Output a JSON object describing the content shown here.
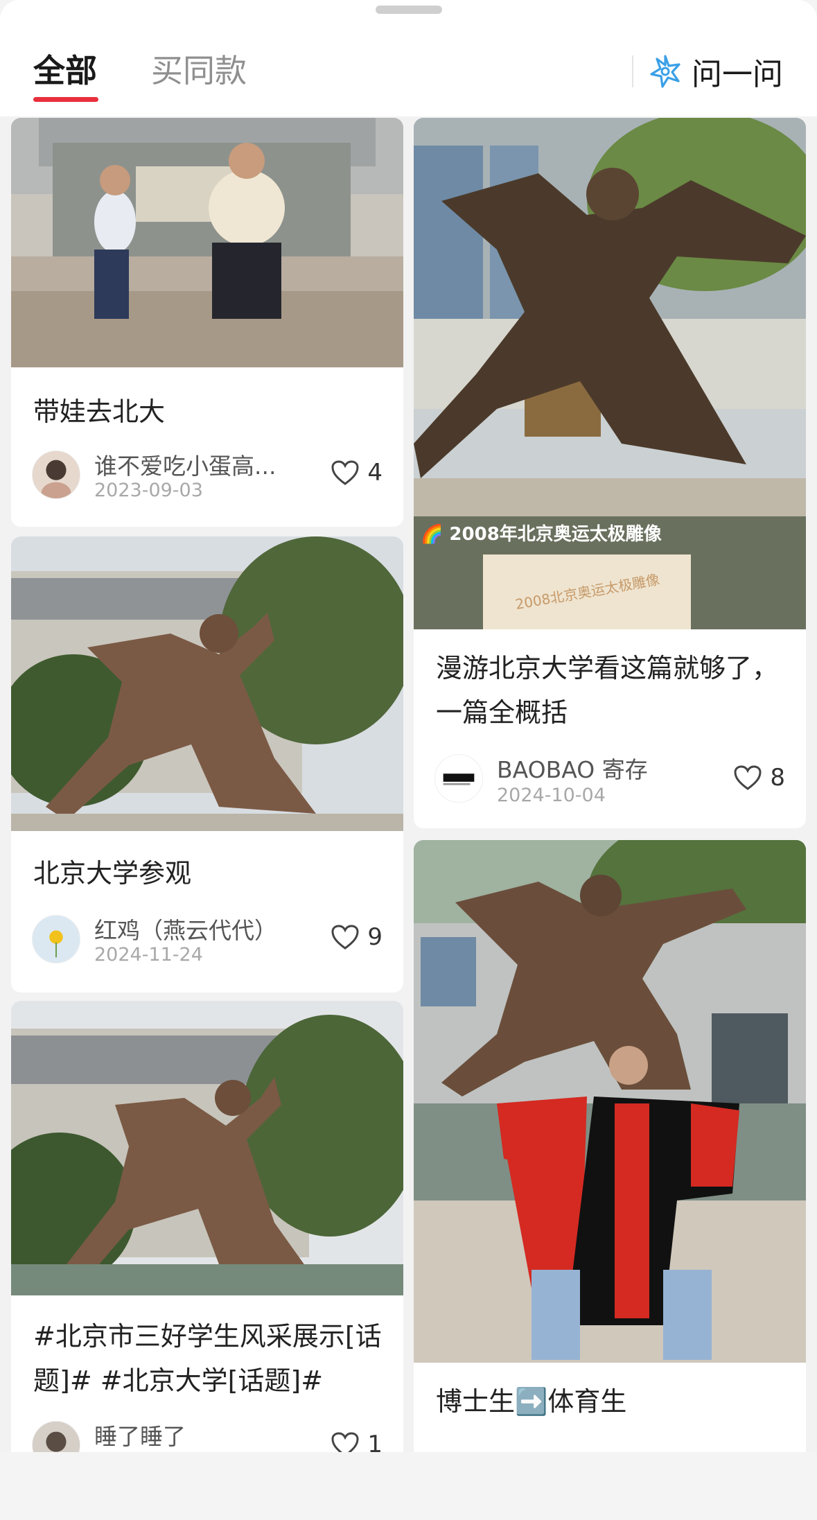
{
  "tabs": {
    "all": "全部",
    "same_style": "买同款"
  },
  "ask": {
    "label": "问一问",
    "icon": "sparkle-star-icon"
  },
  "colors": {
    "accent": "#e8303d",
    "ask_icon": "#3aa0e6",
    "text_muted": "#8f8f8f"
  },
  "posts": [
    {
      "title": "带娃去北大",
      "author": "谁不爱吃小蛋高...",
      "date": "2023-09-03",
      "likes": "4",
      "image": "two-children-posing-photo"
    },
    {
      "title": "漫游北京大学看这篇就够了，一篇全概括",
      "image_caption": "🌈 2008年北京奥运太极雕像",
      "plaque_text": "2008北京奥运太极雕像",
      "author": "BAOBAO 寄存",
      "date": "2024-10-04",
      "likes": "8",
      "image": "tai-chi-statue-photo"
    },
    {
      "title": "北京大学参观",
      "author": "红鸡（燕云代代）",
      "date": "2024-11-24",
      "likes": "9",
      "image": "tai-chi-statue-trees-photo"
    },
    {
      "title": "#北京市三好学生风采展示[话题]# #北京大学[话题]#",
      "author": "睡了睡了",
      "likes": "1",
      "image": "tai-chi-statue-sky-photo"
    },
    {
      "title": "博士生➡️体育生",
      "image": "graduate-gown-pose-photo"
    }
  ]
}
